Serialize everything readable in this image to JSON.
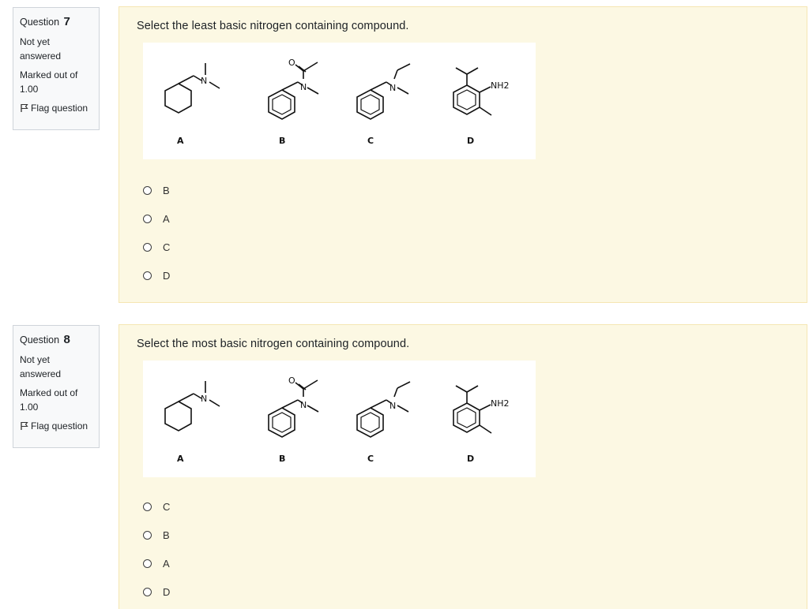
{
  "questions": [
    {
      "number_prefix": "Question",
      "number": "7",
      "state": "Not yet answered",
      "grade": "Marked out of 1.00",
      "flag_label": "Flag question",
      "prompt": "Select the least basic nitrogen containing compound.",
      "figure": {
        "labels": [
          "A",
          "B",
          "C",
          "D"
        ],
        "n_atom": "N",
        "o_atom": "O",
        "nh2_label": "NH2"
      },
      "options": [
        "B",
        "A",
        "C",
        "D"
      ]
    },
    {
      "number_prefix": "Question",
      "number": "8",
      "state": "Not yet answered",
      "grade": "Marked out of 1.00",
      "flag_label": "Flag question",
      "prompt": "Select the most basic nitrogen containing compound.",
      "figure": {
        "labels": [
          "A",
          "B",
          "C",
          "D"
        ],
        "n_atom": "N",
        "o_atom": "O",
        "nh2_label": "NH2"
      },
      "options": [
        "C",
        "B",
        "A",
        "D"
      ]
    }
  ],
  "icons": {
    "flag": "flag-icon",
    "radio": "radio-icon"
  },
  "colors": {
    "content_bg": "#fcf8e3",
    "content_border": "#f5e6b3",
    "info_bg": "#f8f9fa"
  }
}
